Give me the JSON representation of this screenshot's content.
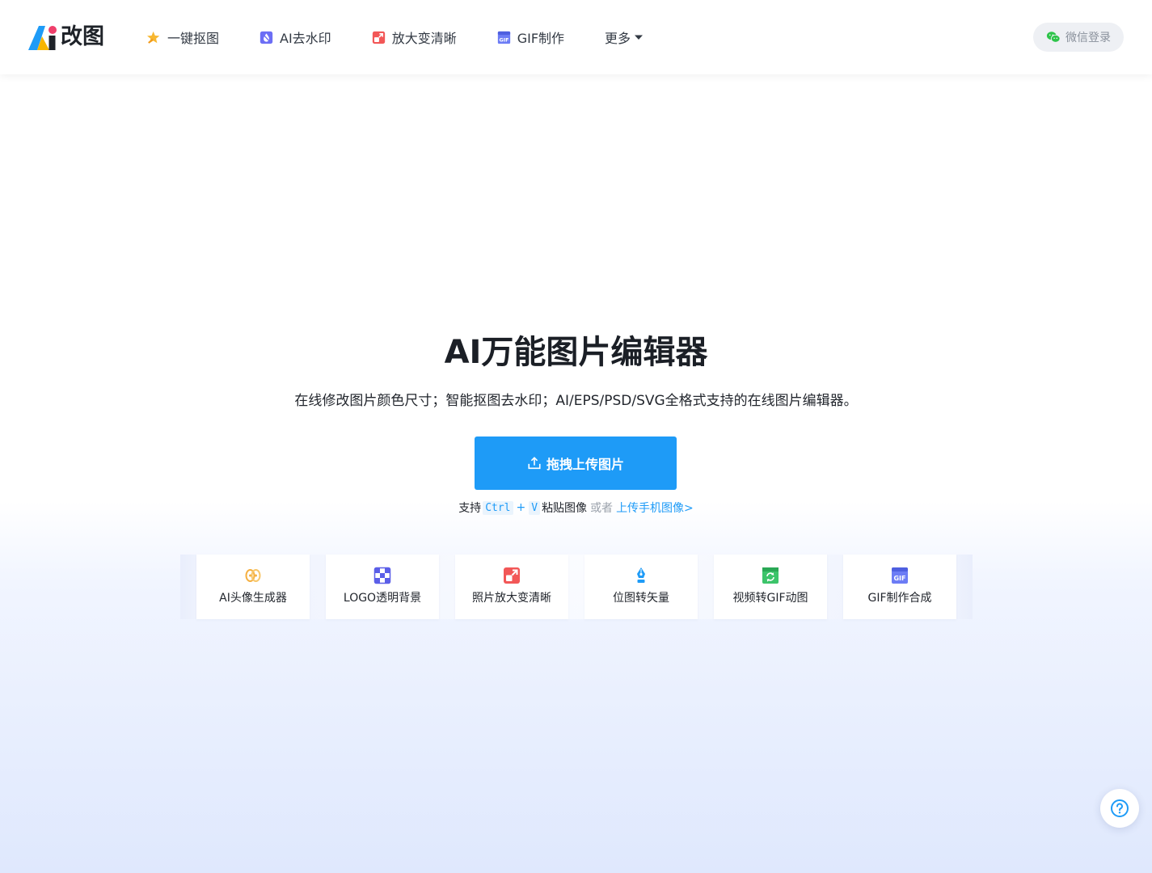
{
  "brand": {
    "logo_text": "改图",
    "colors": {
      "blue": "#1e9bf7",
      "yellow": "#f7b500",
      "pink": "#ef3f6b",
      "dark": "#1f2329"
    }
  },
  "nav": {
    "items": [
      {
        "label": "一键抠图",
        "icon": "magic-star-icon",
        "color": "#f7b731"
      },
      {
        "label": "AI去水印",
        "icon": "watermark-remove-icon",
        "color": "#6c6ef5"
      },
      {
        "label": "放大变清晰",
        "icon": "enlarge-icon",
        "color": "#f25757"
      },
      {
        "label": "GIF制作",
        "icon": "gif-icon",
        "color": "#6c7cf5"
      }
    ],
    "more_label": "更多"
  },
  "login": {
    "label": "微信登录",
    "icon": "wechat-icon",
    "color": "#2ec44a"
  },
  "hero": {
    "title": "AI万能图片编辑器",
    "subtitle": "在线修改图片颜色尺寸；智能抠图去水印；AI/EPS/PSD/SVG全格式支持的在线图片编辑器。",
    "upload_label": "拖拽上传图片",
    "hint": {
      "prefix": "支持",
      "key1": "Ctrl",
      "plus": "+",
      "key2": "V",
      "paste": "粘贴图像",
      "or": "或者",
      "mobile_link": "上传手机图像>"
    }
  },
  "tools": [
    {
      "label": "AI头像生成器",
      "icon": "ai-avatar-icon",
      "color": "#f5b041"
    },
    {
      "label": "LOGO透明背景",
      "icon": "transparent-grid-icon",
      "color": "#5b5fe8"
    },
    {
      "label": "照片放大变清晰",
      "icon": "enlarge-icon",
      "color": "#f25757"
    },
    {
      "label": "位图转矢量",
      "icon": "pen-nib-icon",
      "color": "#1e9bf7"
    },
    {
      "label": "视频转GIF动图",
      "icon": "video-convert-icon",
      "color": "#3cc46a"
    },
    {
      "label": "GIF制作合成",
      "icon": "gif-icon",
      "color": "#6c7cf5"
    }
  ],
  "help": {
    "icon": "help-question-icon",
    "color": "#1e9bf7"
  }
}
